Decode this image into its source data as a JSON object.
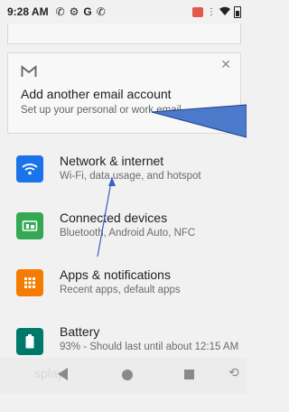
{
  "status_bar": {
    "time": "9:28 AM",
    "icons": [
      "phone-icon",
      "gear-icon",
      "google-g-icon",
      "phone-icon"
    ]
  },
  "email_card": {
    "title": "Add another email account",
    "subtitle": "Set up your personal or work email"
  },
  "settings": [
    {
      "label": "Network & internet",
      "desc": "Wi-Fi, data usage, and hotspot",
      "icon": "wifi-icon",
      "color": "#1a73e8"
    },
    {
      "label": "Connected devices",
      "desc": "Bluetooth, Android Auto, NFC",
      "icon": "devices-icon",
      "color": "#34a853"
    },
    {
      "label": "Apps & notifications",
      "desc": "Recent apps, default apps",
      "icon": "apps-icon",
      "color": "#f57c00"
    },
    {
      "label": "Battery",
      "desc": "93% - Should last until about 12:15 AM",
      "icon": "battery-icon",
      "color": "#00796b"
    }
  ],
  "nav": {
    "faded_label": "splay"
  }
}
